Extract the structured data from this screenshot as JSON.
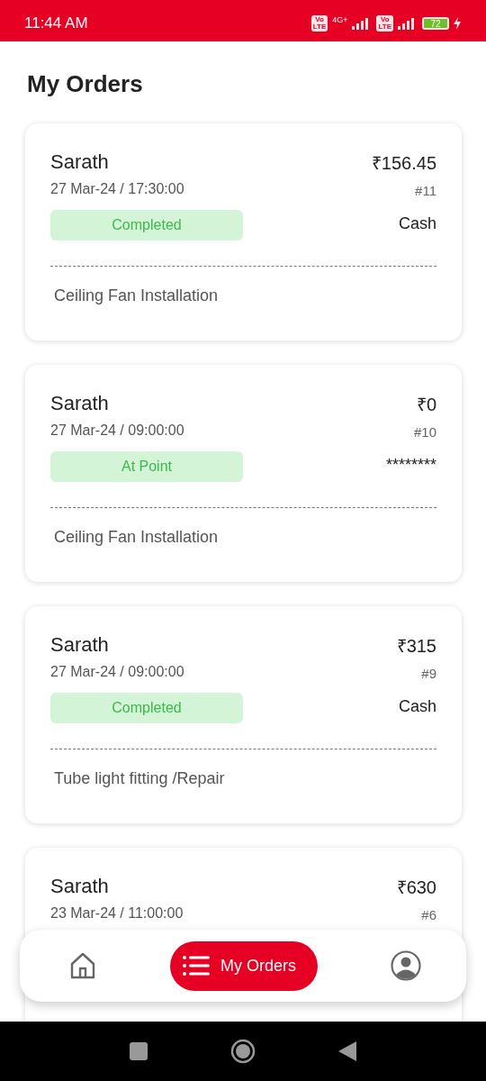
{
  "status_bar": {
    "time": "11:44 AM",
    "sims": [
      {
        "top": "Vo",
        "bottom": "LTE",
        "network": "4G+"
      },
      {
        "top": "Vo",
        "bottom": "LTE"
      }
    ],
    "battery": "72"
  },
  "title": "My Orders",
  "orders": [
    {
      "customer": "Sarath",
      "datetime": "27 Mar-24 / 17:30:00",
      "amount": "₹156.45",
      "number": "#11",
      "status": "Completed",
      "payment": "Cash",
      "service": "Ceiling Fan Installation"
    },
    {
      "customer": "Sarath",
      "datetime": "27 Mar-24 / 09:00:00",
      "amount": "₹0",
      "number": "#10",
      "status": "At Point",
      "payment": "********",
      "service": "Ceiling Fan Installation"
    },
    {
      "customer": "Sarath",
      "datetime": "27 Mar-24 / 09:00:00",
      "amount": "₹315",
      "number": "#9",
      "status": "Completed",
      "payment": "Cash",
      "service": "Tube light fitting /Repair"
    },
    {
      "customer": "Sarath",
      "datetime": "23 Mar-24 / 11:00:00",
      "amount": "₹630",
      "number": "#6"
    }
  ],
  "bottom_nav": [
    {
      "kind": "home",
      "selected": false
    },
    {
      "kind": "orders",
      "label": "My Orders",
      "selected": true
    },
    {
      "kind": "profile",
      "selected": false
    }
  ]
}
